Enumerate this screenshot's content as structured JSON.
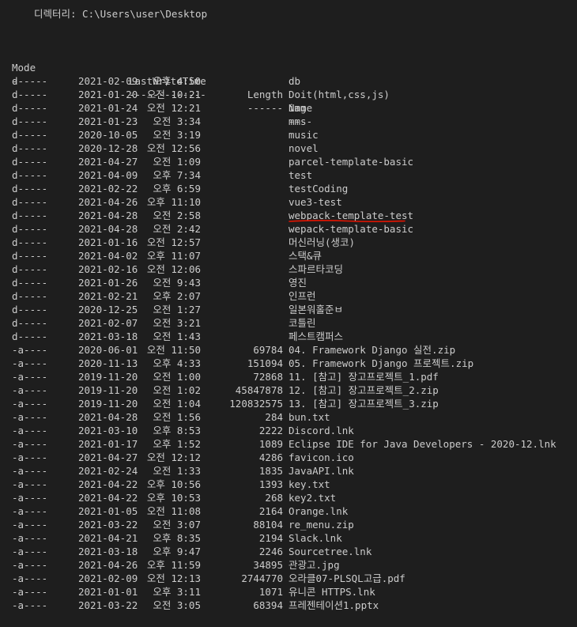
{
  "header": {
    "directory_label": "디렉터리: C:\\Users\\user\\Desktop"
  },
  "columns": {
    "mode": "Mode",
    "lastwritetime": "LastWriteTime",
    "length": "Length",
    "name": "Name",
    "mode_sep": "----",
    "lastwritetime_sep": "-------------",
    "length_sep": "------",
    "name_sep": "----"
  },
  "annotation_color": "#e51400",
  "rows": [
    {
      "mode": "d-----",
      "date": "2021-02-09",
      "time": "오후 4:50",
      "length": "",
      "name": "db"
    },
    {
      "mode": "d-----",
      "date": "2021-01-20",
      "time": "오전 10:21",
      "length": "",
      "name": "Doit(html,css,js)"
    },
    {
      "mode": "d-----",
      "date": "2021-01-24",
      "time": "오전 12:21",
      "length": "",
      "name": "img"
    },
    {
      "mode": "d-----",
      "date": "2021-01-23",
      "time": "오전 3:34",
      "length": "",
      "name": "mms"
    },
    {
      "mode": "d-----",
      "date": "2020-10-05",
      "time": "오전 3:19",
      "length": "",
      "name": "music"
    },
    {
      "mode": "d-----",
      "date": "2020-12-28",
      "time": "오전 12:56",
      "length": "",
      "name": "novel"
    },
    {
      "mode": "d-----",
      "date": "2021-04-27",
      "time": "오전 1:09",
      "length": "",
      "name": "parcel-template-basic"
    },
    {
      "mode": "d-----",
      "date": "2021-04-09",
      "time": "오후 7:34",
      "length": "",
      "name": "test"
    },
    {
      "mode": "d-----",
      "date": "2021-02-22",
      "time": "오후 6:59",
      "length": "",
      "name": "testCoding"
    },
    {
      "mode": "d-----",
      "date": "2021-04-26",
      "time": "오후 11:10",
      "length": "",
      "name": "vue3-test"
    },
    {
      "mode": "d-----",
      "date": "2021-04-28",
      "time": "오전 2:58",
      "length": "",
      "name": "webpack-template-test"
    },
    {
      "mode": "d-----",
      "date": "2021-04-28",
      "time": "오전 2:42",
      "length": "",
      "name": "wepack-template-basic"
    },
    {
      "mode": "d-----",
      "date": "2021-01-16",
      "time": "오전 12:57",
      "length": "",
      "name": "머신러닝(생코)"
    },
    {
      "mode": "d-----",
      "date": "2021-04-02",
      "time": "오후 11:07",
      "length": "",
      "name": "스택&큐"
    },
    {
      "mode": "d-----",
      "date": "2021-02-16",
      "time": "오전 12:06",
      "length": "",
      "name": "스파르타코딩"
    },
    {
      "mode": "d-----",
      "date": "2021-01-26",
      "time": "오전 9:43",
      "length": "",
      "name": "영진"
    },
    {
      "mode": "d-----",
      "date": "2021-02-21",
      "time": "오후 2:07",
      "length": "",
      "name": "인프런"
    },
    {
      "mode": "d-----",
      "date": "2020-12-25",
      "time": "오전 1:27",
      "length": "",
      "name": "일본워홀준ㅂ"
    },
    {
      "mode": "d-----",
      "date": "2021-02-07",
      "time": "오전 3:21",
      "length": "",
      "name": "코틀린"
    },
    {
      "mode": "d-----",
      "date": "2021-03-18",
      "time": "오전 1:43",
      "length": "",
      "name": "페스트캠퍼스"
    },
    {
      "mode": "-a----",
      "date": "2020-06-01",
      "time": "오전 11:50",
      "length": "69784",
      "name": "04. Framework Django 실전.zip"
    },
    {
      "mode": "-a----",
      "date": "2020-11-13",
      "time": "오후 4:33",
      "length": "151094",
      "name": "05. Framework Django 프로젝트.zip"
    },
    {
      "mode": "-a----",
      "date": "2019-11-20",
      "time": "오전 1:00",
      "length": "72868",
      "name": "11. [참고] 장고프로젝트_1.pdf"
    },
    {
      "mode": "-a----",
      "date": "2019-11-20",
      "time": "오전 1:02",
      "length": "45847878",
      "name": "12. [참고] 장고프로젝트_2.zip"
    },
    {
      "mode": "-a----",
      "date": "2019-11-20",
      "time": "오전 1:04",
      "length": "120832575",
      "name": "13. [참고] 장고프로젝트_3.zip"
    },
    {
      "mode": "-a----",
      "date": "2021-04-28",
      "time": "오전 1:56",
      "length": "284",
      "name": "bun.txt"
    },
    {
      "mode": "-a----",
      "date": "2021-03-10",
      "time": "오후 8:53",
      "length": "2222",
      "name": "Discord.lnk"
    },
    {
      "mode": "-a----",
      "date": "2021-01-17",
      "time": "오후 1:52",
      "length": "1089",
      "name": "Eclipse IDE for Java Developers - 2020-12.lnk"
    },
    {
      "mode": "-a----",
      "date": "2021-04-27",
      "time": "오전 12:12",
      "length": "4286",
      "name": "favicon.ico"
    },
    {
      "mode": "-a----",
      "date": "2021-02-24",
      "time": "오전 1:33",
      "length": "1835",
      "name": "JavaAPI.lnk"
    },
    {
      "mode": "-a----",
      "date": "2021-04-22",
      "time": "오후 10:56",
      "length": "1393",
      "name": "key.txt"
    },
    {
      "mode": "-a----",
      "date": "2021-04-22",
      "time": "오후 10:53",
      "length": "268",
      "name": "key2.txt"
    },
    {
      "mode": "-a----",
      "date": "2021-01-05",
      "time": "오전 11:08",
      "length": "2164",
      "name": "Orange.lnk"
    },
    {
      "mode": "-a----",
      "date": "2021-03-22",
      "time": "오전 3:07",
      "length": "88104",
      "name": "re_menu.zip"
    },
    {
      "mode": "-a----",
      "date": "2021-04-21",
      "time": "오후 8:35",
      "length": "2194",
      "name": "Slack.lnk"
    },
    {
      "mode": "-a----",
      "date": "2021-03-18",
      "time": "오후 9:47",
      "length": "2246",
      "name": "Sourcetree.lnk"
    },
    {
      "mode": "-a----",
      "date": "2021-04-26",
      "time": "오후 11:59",
      "length": "34895",
      "name": "관광고.jpg"
    },
    {
      "mode": "-a----",
      "date": "2021-02-09",
      "time": "오전 12:13",
      "length": "2744770",
      "name": "오라클07-PLSQL고급.pdf"
    },
    {
      "mode": "-a----",
      "date": "2021-01-01",
      "time": "오후 3:11",
      "length": "1071",
      "name": "유니콘 HTTPS.lnk"
    },
    {
      "mode": "-a----",
      "date": "2021-03-22",
      "time": "오전 3:05",
      "length": "68394",
      "name": "프레젠테이션1.pptx"
    }
  ]
}
